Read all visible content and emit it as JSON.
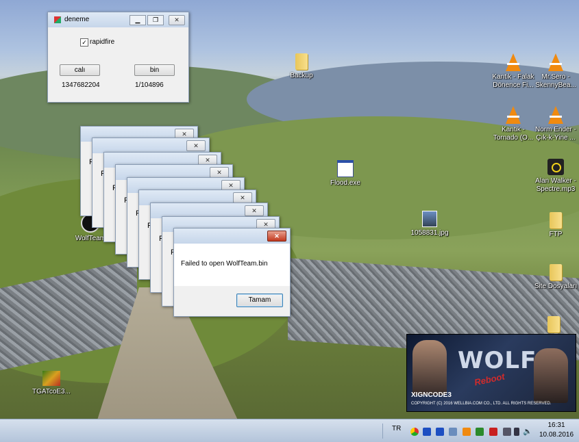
{
  "colors": {
    "accent": "#2b4fa8",
    "close_red": "#c2381e",
    "splash_red": "#d12b2b"
  },
  "main_window": {
    "title": "deneme",
    "checkbox_label": "rapidfire",
    "checkbox_checked": true,
    "button_left": "calı",
    "button_right": "bin",
    "value_left": "1347682204",
    "value_right": "1/104896"
  },
  "stacked_windows": {
    "count": 8,
    "letter": "F"
  },
  "error_dialog": {
    "message": "Failed to open WolfTeam.bin",
    "ok_button": "Tamam"
  },
  "desktop_icons": [
    {
      "label": "Backup",
      "icon": "folder-icon"
    },
    {
      "label": "Kantik - Falak Dönence Fi...",
      "icon": "vlc-icon"
    },
    {
      "label": "Mr.Sero - SkennyBea...",
      "icon": "vlc-icon"
    },
    {
      "label": "Kantik - Tornado (O...",
      "icon": "vlc-icon"
    },
    {
      "label": "Norm Ender - Çık-k-Yine ...",
      "icon": "vlc-icon"
    },
    {
      "label": "Flood.exe",
      "icon": "exe-icon"
    },
    {
      "label": "Alan Walker - Spectre.mp3",
      "icon": "music-icon"
    },
    {
      "label": "WolfTeam",
      "icon": "wolfteam-icon"
    },
    {
      "label": "1058831.jpg",
      "icon": "photo-icon"
    },
    {
      "label": "FTP",
      "icon": "folder-icon"
    },
    {
      "label": "Site Dosyaları",
      "icon": "folder-icon"
    },
    {
      "label": "TGATcoE3...",
      "icon": "app-icon"
    }
  ],
  "splash": {
    "logo": "WOLF",
    "logo_sub": "Reboot",
    "brand": "XIGNCODE3",
    "copyright": "COPYRIGHT (C) 2016 WELLBIA.COM CO., LTD. ALL RIGHTS RESERVED."
  },
  "taskbar": {
    "language": "TR",
    "time": "16:31",
    "date": "10.08.2016",
    "tray_icons": [
      "chrome-icon",
      "x-icon",
      "x-icon",
      "user-icon",
      "vlc-icon",
      "green-icon",
      "red-icon",
      "network-icon",
      "battery-icon",
      "speaker-icon"
    ]
  }
}
